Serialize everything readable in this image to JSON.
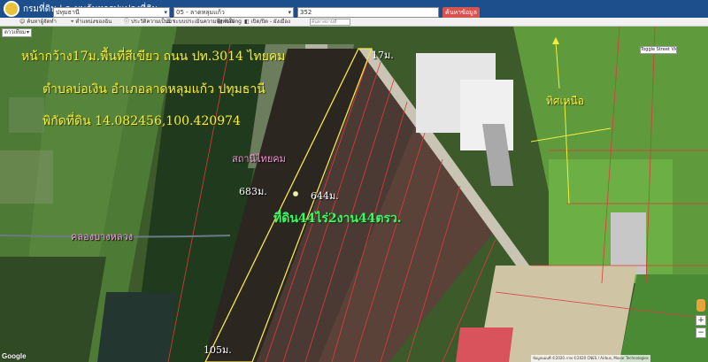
{
  "header": {
    "site_title": "กรมที่ดิน | ระบบค้นหารูปแปลงที่ดิน"
  },
  "search": {
    "province": "ปทุมธานี",
    "district": "05 - ลาดหลุมแก้ว",
    "parcel_no": "352",
    "button_label": "ค้นหาข้อมูล"
  },
  "toolbar": {
    "items": [
      "ค้นหาผู้จัดทำ",
      "ตำแหน่งของฉัน",
      "ประวัติความเป็นมา",
      "ระบบประเมินความพึงพอใจ",
      "Rating",
      "เปิด/ปิด - ผังเมือง"
    ],
    "search_placeholder": "ค้นหาสถานที่"
  },
  "map": {
    "type_label": "ดาวเทียม",
    "toggle_street_view": "Toggle Street View",
    "annotations": {
      "frontage": "หน้ากว้าง17ม.พื้นที่สีเขียว ถนน ปท.3014 ไทยคม",
      "location": "ตำบลบ่อเงิน อำเภอลาดหลุมแก้ว ปทุมธานี",
      "coords": "พิกัดที่ดิน 14.082456,100.420974",
      "station": "สถานีไทยคม",
      "side_683": "683ม.",
      "side_644": "644ม.",
      "side_17": "17ม.",
      "side_105": "105ม.",
      "area": "ที่ดิน44ไร่2งาน44ตรว.",
      "canal": "คลองบางหลวง",
      "north": "ทิศเหนือ"
    },
    "colors": {
      "parcel_border": "#e0393e",
      "highlight_border": "#f5e64a",
      "road": "#c9c4b4"
    }
  },
  "footer": {
    "google": "Google",
    "attribution": "ข้อมูลแผนที่ ©2020 ภาพ ©2020 CNES / Airbus, Maxar Technologies"
  }
}
